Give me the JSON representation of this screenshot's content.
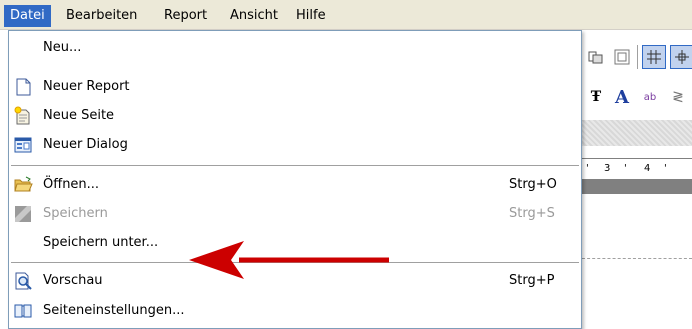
{
  "menubar": {
    "items": [
      {
        "label": "Datei"
      },
      {
        "label": "Bearbeiten"
      },
      {
        "label": "Report"
      },
      {
        "label": "Ansicht"
      },
      {
        "label": "Hilfe"
      }
    ]
  },
  "dropdown": {
    "items": [
      {
        "label": "Neu...",
        "icon": "none"
      },
      {
        "label": "Neuer Report",
        "icon": "blank-page-icon"
      },
      {
        "label": "Neue Seite",
        "icon": "new-page-icon"
      },
      {
        "label": "Neuer Dialog",
        "icon": "dialog-icon"
      },
      {
        "label": "Öffnen...",
        "shortcut": "Strg+O",
        "icon": "open-folder-icon"
      },
      {
        "label": "Speichern",
        "shortcut": "Strg+S",
        "icon": "save-icon",
        "disabled": true
      },
      {
        "label": "Speichern unter...",
        "icon": "none"
      },
      {
        "label": "Vorschau",
        "shortcut": "Strg+P",
        "icon": "preview-icon"
      },
      {
        "label": "Seiteneinstellungen...",
        "icon": "page-setup-icon"
      }
    ]
  },
  "background": {
    "ruler_labels": [
      "3",
      "4"
    ]
  },
  "colors": {
    "menu_highlight": "#316ac5",
    "arrow": "#cc0000"
  }
}
